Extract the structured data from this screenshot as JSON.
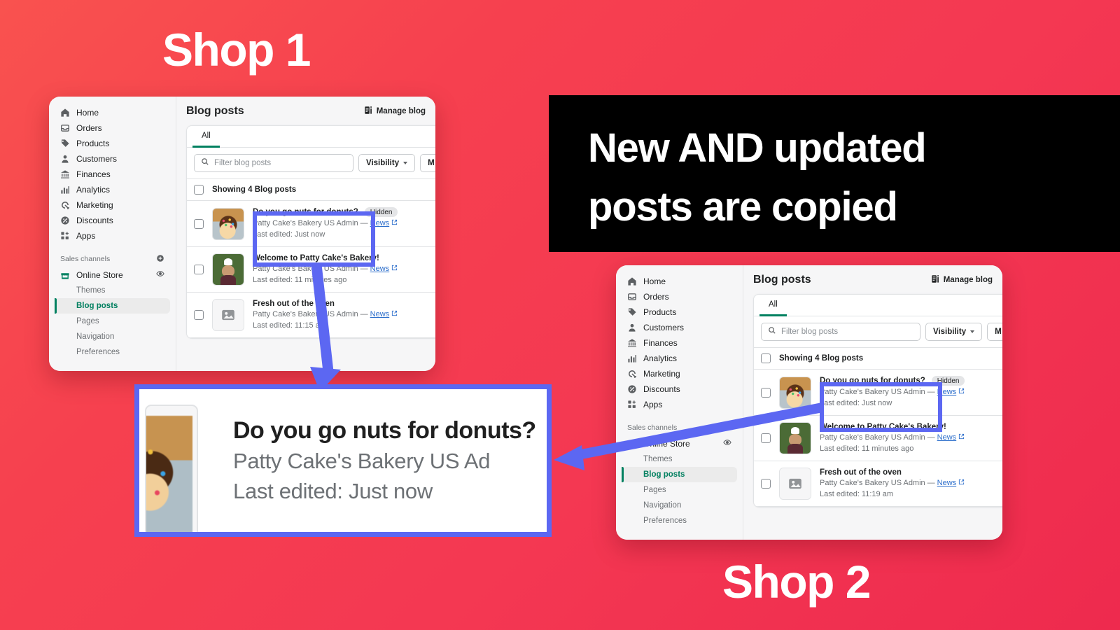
{
  "background": {
    "color_start": "#f9524f",
    "color_end": "#ee2a4e"
  },
  "headings": {
    "shop1": "Shop 1",
    "shop2": "Shop 2"
  },
  "banner": {
    "background": "#000000",
    "line1": "New AND updated",
    "line2": "posts are copied"
  },
  "highlight_color": "#5c67f2",
  "shop1": {
    "nav": {
      "items": [
        {
          "label": "Home",
          "icon": "home-icon"
        },
        {
          "label": "Orders",
          "icon": "orders-icon"
        },
        {
          "label": "Products",
          "icon": "products-icon"
        },
        {
          "label": "Customers",
          "icon": "customers-icon"
        },
        {
          "label": "Finances",
          "icon": "finances-icon"
        },
        {
          "label": "Analytics",
          "icon": "analytics-icon"
        },
        {
          "label": "Marketing",
          "icon": "marketing-icon"
        },
        {
          "label": "Discounts",
          "icon": "discounts-icon"
        },
        {
          "label": "Apps",
          "icon": "apps-icon"
        }
      ],
      "sales_channels_label": "Sales channels",
      "add_channel_icon": "plus-circle-icon",
      "online_store": "Online Store",
      "view_store_icon": "eye-icon",
      "sub_items": [
        {
          "label": "Themes",
          "active": false
        },
        {
          "label": "Blog posts",
          "active": true
        },
        {
          "label": "Pages",
          "active": false
        },
        {
          "label": "Navigation",
          "active": false
        },
        {
          "label": "Preferences",
          "active": false
        }
      ]
    },
    "header": {
      "title": "Blog posts",
      "manage_blog_label": "Manage blog",
      "manage_blog_icon": "blog-icon"
    },
    "tabs": [
      {
        "label": "All",
        "active": true
      }
    ],
    "filter": {
      "search_placeholder": "Filter blog posts",
      "search_icon": "search-icon",
      "visibility_label": "Visibility",
      "more_label": "M"
    },
    "list": {
      "showing_label": "Showing 4 Blog posts",
      "posts": [
        {
          "title": "Do you go nuts for donuts?",
          "badge": "Hidden",
          "author": "Patty Cake's Bakery US Admin",
          "separator": "—",
          "blog": "News",
          "edited": "Last edited: Just now",
          "thumb": "donut"
        },
        {
          "title": "Welcome to Patty Cake's Bakery!",
          "badge": "",
          "author": "Patty Cake's Bakery US Admin",
          "separator": "—",
          "blog": "News",
          "edited": "Last edited: 11 minutes ago",
          "thumb": "person"
        },
        {
          "title": "Fresh out of the oven",
          "badge": "",
          "author": "Patty Cake's Bakery US Admin",
          "separator": "—",
          "blog": "News",
          "edited": "Last edited: 11:15 am",
          "thumb": "placeholder"
        }
      ]
    }
  },
  "shop2": {
    "nav": {
      "items": [
        {
          "label": "Home",
          "icon": "home-icon"
        },
        {
          "label": "Orders",
          "icon": "orders-icon"
        },
        {
          "label": "Products",
          "icon": "products-icon"
        },
        {
          "label": "Customers",
          "icon": "customers-icon"
        },
        {
          "label": "Finances",
          "icon": "finances-icon"
        },
        {
          "label": "Analytics",
          "icon": "analytics-icon"
        },
        {
          "label": "Marketing",
          "icon": "marketing-icon"
        },
        {
          "label": "Discounts",
          "icon": "discounts-icon"
        },
        {
          "label": "Apps",
          "icon": "apps-icon"
        }
      ],
      "sales_channels_label": "Sales channels",
      "add_channel_icon": "plus-circle-icon",
      "online_store": "Online Store",
      "view_store_icon": "eye-icon",
      "sub_items": [
        {
          "label": "Themes",
          "active": false
        },
        {
          "label": "Blog posts",
          "active": true
        },
        {
          "label": "Pages",
          "active": false
        },
        {
          "label": "Navigation",
          "active": false
        },
        {
          "label": "Preferences",
          "active": false
        }
      ]
    },
    "header": {
      "title": "Blog posts",
      "manage_blog_label": "Manage blog",
      "manage_blog_icon": "blog-icon"
    },
    "tabs": [
      {
        "label": "All",
        "active": true
      }
    ],
    "filter": {
      "search_placeholder": "Filter blog posts",
      "search_icon": "search-icon",
      "visibility_label": "Visibility",
      "more_label": "M"
    },
    "list": {
      "showing_label": "Showing 4 Blog posts",
      "posts": [
        {
          "title": "Do you go nuts for donuts?",
          "badge": "Hidden",
          "author": "Patty Cake's Bakery US Admin",
          "separator": "—",
          "blog": "News",
          "edited": "Last edited: Just now",
          "thumb": "donut"
        },
        {
          "title": "Welcome to Patty Cake's Bakery!",
          "badge": "",
          "author": "Patty Cake's Bakery US Admin",
          "separator": "—",
          "blog": "News",
          "edited": "Last edited: 11 minutes ago",
          "thumb": "person"
        },
        {
          "title": "Fresh out of the oven",
          "badge": "",
          "author": "Patty Cake's Bakery US Admin",
          "separator": "—",
          "blog": "News",
          "edited": "Last edited: 11:19 am",
          "thumb": "placeholder"
        }
      ]
    }
  },
  "callout": {
    "title": "Do you go nuts for donuts?",
    "author": "Patty Cake's Bakery US Ad",
    "edited": "Last edited: Just now",
    "underline_color": "#ef4452",
    "border_color": "#5c67f2"
  }
}
